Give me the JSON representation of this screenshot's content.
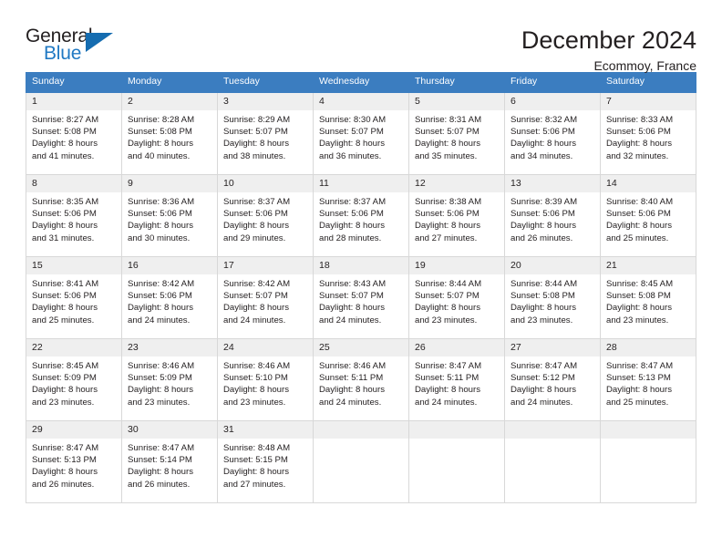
{
  "brand": {
    "name_top": "General",
    "name_bottom": "Blue",
    "accent_color": "#2079c3",
    "triangle_color": "#156cb0"
  },
  "header": {
    "title": "December 2024",
    "subtitle": "Ecommoy, France"
  },
  "theme": {
    "header_row_bg": "#3b7dc0",
    "daynum_bg": "#efefef",
    "grid_border": "#d8d8d8",
    "text_color": "#231f20"
  },
  "weekday_headers": [
    "Sunday",
    "Monday",
    "Tuesday",
    "Wednesday",
    "Thursday",
    "Friday",
    "Saturday"
  ],
  "weeks": [
    [
      {
        "day": "1",
        "sunrise": "Sunrise: 8:27 AM",
        "sunset": "Sunset: 5:08 PM",
        "daylight_line1": "Daylight: 8 hours",
        "daylight_line2": "and 41 minutes."
      },
      {
        "day": "2",
        "sunrise": "Sunrise: 8:28 AM",
        "sunset": "Sunset: 5:08 PM",
        "daylight_line1": "Daylight: 8 hours",
        "daylight_line2": "and 40 minutes."
      },
      {
        "day": "3",
        "sunrise": "Sunrise: 8:29 AM",
        "sunset": "Sunset: 5:07 PM",
        "daylight_line1": "Daylight: 8 hours",
        "daylight_line2": "and 38 minutes."
      },
      {
        "day": "4",
        "sunrise": "Sunrise: 8:30 AM",
        "sunset": "Sunset: 5:07 PM",
        "daylight_line1": "Daylight: 8 hours",
        "daylight_line2": "and 36 minutes."
      },
      {
        "day": "5",
        "sunrise": "Sunrise: 8:31 AM",
        "sunset": "Sunset: 5:07 PM",
        "daylight_line1": "Daylight: 8 hours",
        "daylight_line2": "and 35 minutes."
      },
      {
        "day": "6",
        "sunrise": "Sunrise: 8:32 AM",
        "sunset": "Sunset: 5:06 PM",
        "daylight_line1": "Daylight: 8 hours",
        "daylight_line2": "and 34 minutes."
      },
      {
        "day": "7",
        "sunrise": "Sunrise: 8:33 AM",
        "sunset": "Sunset: 5:06 PM",
        "daylight_line1": "Daylight: 8 hours",
        "daylight_line2": "and 32 minutes."
      }
    ],
    [
      {
        "day": "8",
        "sunrise": "Sunrise: 8:35 AM",
        "sunset": "Sunset: 5:06 PM",
        "daylight_line1": "Daylight: 8 hours",
        "daylight_line2": "and 31 minutes."
      },
      {
        "day": "9",
        "sunrise": "Sunrise: 8:36 AM",
        "sunset": "Sunset: 5:06 PM",
        "daylight_line1": "Daylight: 8 hours",
        "daylight_line2": "and 30 minutes."
      },
      {
        "day": "10",
        "sunrise": "Sunrise: 8:37 AM",
        "sunset": "Sunset: 5:06 PM",
        "daylight_line1": "Daylight: 8 hours",
        "daylight_line2": "and 29 minutes."
      },
      {
        "day": "11",
        "sunrise": "Sunrise: 8:37 AM",
        "sunset": "Sunset: 5:06 PM",
        "daylight_line1": "Daylight: 8 hours",
        "daylight_line2": "and 28 minutes."
      },
      {
        "day": "12",
        "sunrise": "Sunrise: 8:38 AM",
        "sunset": "Sunset: 5:06 PM",
        "daylight_line1": "Daylight: 8 hours",
        "daylight_line2": "and 27 minutes."
      },
      {
        "day": "13",
        "sunrise": "Sunrise: 8:39 AM",
        "sunset": "Sunset: 5:06 PM",
        "daylight_line1": "Daylight: 8 hours",
        "daylight_line2": "and 26 minutes."
      },
      {
        "day": "14",
        "sunrise": "Sunrise: 8:40 AM",
        "sunset": "Sunset: 5:06 PM",
        "daylight_line1": "Daylight: 8 hours",
        "daylight_line2": "and 25 minutes."
      }
    ],
    [
      {
        "day": "15",
        "sunrise": "Sunrise: 8:41 AM",
        "sunset": "Sunset: 5:06 PM",
        "daylight_line1": "Daylight: 8 hours",
        "daylight_line2": "and 25 minutes."
      },
      {
        "day": "16",
        "sunrise": "Sunrise: 8:42 AM",
        "sunset": "Sunset: 5:06 PM",
        "daylight_line1": "Daylight: 8 hours",
        "daylight_line2": "and 24 minutes."
      },
      {
        "day": "17",
        "sunrise": "Sunrise: 8:42 AM",
        "sunset": "Sunset: 5:07 PM",
        "daylight_line1": "Daylight: 8 hours",
        "daylight_line2": "and 24 minutes."
      },
      {
        "day": "18",
        "sunrise": "Sunrise: 8:43 AM",
        "sunset": "Sunset: 5:07 PM",
        "daylight_line1": "Daylight: 8 hours",
        "daylight_line2": "and 24 minutes."
      },
      {
        "day": "19",
        "sunrise": "Sunrise: 8:44 AM",
        "sunset": "Sunset: 5:07 PM",
        "daylight_line1": "Daylight: 8 hours",
        "daylight_line2": "and 23 minutes."
      },
      {
        "day": "20",
        "sunrise": "Sunrise: 8:44 AM",
        "sunset": "Sunset: 5:08 PM",
        "daylight_line1": "Daylight: 8 hours",
        "daylight_line2": "and 23 minutes."
      },
      {
        "day": "21",
        "sunrise": "Sunrise: 8:45 AM",
        "sunset": "Sunset: 5:08 PM",
        "daylight_line1": "Daylight: 8 hours",
        "daylight_line2": "and 23 minutes."
      }
    ],
    [
      {
        "day": "22",
        "sunrise": "Sunrise: 8:45 AM",
        "sunset": "Sunset: 5:09 PM",
        "daylight_line1": "Daylight: 8 hours",
        "daylight_line2": "and 23 minutes."
      },
      {
        "day": "23",
        "sunrise": "Sunrise: 8:46 AM",
        "sunset": "Sunset: 5:09 PM",
        "daylight_line1": "Daylight: 8 hours",
        "daylight_line2": "and 23 minutes."
      },
      {
        "day": "24",
        "sunrise": "Sunrise: 8:46 AM",
        "sunset": "Sunset: 5:10 PM",
        "daylight_line1": "Daylight: 8 hours",
        "daylight_line2": "and 23 minutes."
      },
      {
        "day": "25",
        "sunrise": "Sunrise: 8:46 AM",
        "sunset": "Sunset: 5:11 PM",
        "daylight_line1": "Daylight: 8 hours",
        "daylight_line2": "and 24 minutes."
      },
      {
        "day": "26",
        "sunrise": "Sunrise: 8:47 AM",
        "sunset": "Sunset: 5:11 PM",
        "daylight_line1": "Daylight: 8 hours",
        "daylight_line2": "and 24 minutes."
      },
      {
        "day": "27",
        "sunrise": "Sunrise: 8:47 AM",
        "sunset": "Sunset: 5:12 PM",
        "daylight_line1": "Daylight: 8 hours",
        "daylight_line2": "and 24 minutes."
      },
      {
        "day": "28",
        "sunrise": "Sunrise: 8:47 AM",
        "sunset": "Sunset: 5:13 PM",
        "daylight_line1": "Daylight: 8 hours",
        "daylight_line2": "and 25 minutes."
      }
    ],
    [
      {
        "day": "29",
        "sunrise": "Sunrise: 8:47 AM",
        "sunset": "Sunset: 5:13 PM",
        "daylight_line1": "Daylight: 8 hours",
        "daylight_line2": "and 26 minutes."
      },
      {
        "day": "30",
        "sunrise": "Sunrise: 8:47 AM",
        "sunset": "Sunset: 5:14 PM",
        "daylight_line1": "Daylight: 8 hours",
        "daylight_line2": "and 26 minutes."
      },
      {
        "day": "31",
        "sunrise": "Sunrise: 8:48 AM",
        "sunset": "Sunset: 5:15 PM",
        "daylight_line1": "Daylight: 8 hours",
        "daylight_line2": "and 27 minutes."
      },
      {
        "day": "",
        "sunrise": "",
        "sunset": "",
        "daylight_line1": "",
        "daylight_line2": ""
      },
      {
        "day": "",
        "sunrise": "",
        "sunset": "",
        "daylight_line1": "",
        "daylight_line2": ""
      },
      {
        "day": "",
        "sunrise": "",
        "sunset": "",
        "daylight_line1": "",
        "daylight_line2": ""
      },
      {
        "day": "",
        "sunrise": "",
        "sunset": "",
        "daylight_line1": "",
        "daylight_line2": ""
      }
    ]
  ]
}
